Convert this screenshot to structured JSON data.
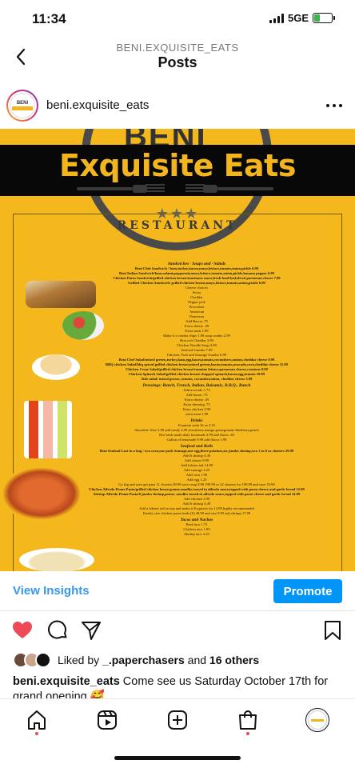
{
  "status_bar": {
    "time": "11:34",
    "network": "5GE",
    "battery_level": 0.35,
    "battery_color": "#3bb54a"
  },
  "header": {
    "subtitle": "BENI.EXQUISITE_EATS",
    "title": "Posts",
    "back_icon": "chevron-left-icon"
  },
  "post": {
    "username": "beni.exquisite_eats",
    "more_icon": "more-horizontal-icon",
    "image": {
      "logo_partial": "BENI",
      "brand_title": "Exquisite Eats",
      "subtitle": "RESTAURANT",
      "stars": "★★★",
      "background_color": "#f4b71c",
      "menu_lines": [
        {
          "text": "Sandwiches · Soups and · Salads",
          "style": "h"
        },
        {
          "text": "Beni Club Sandwich / ham,turkey,bacon,mayo,lettuce,tomato,onion,pickle 6.99",
          "style": "b"
        },
        {
          "text": "Beni Italian Sandwich/ham,salami,pepperoni,mayo,lettuce,tomato,onion,pickle,banana pepper 6.99",
          "style": "b"
        },
        {
          "text": "Chicken Parm Sandwich/grilled chicken breast/marinara sauce,fresh basil leaf,sliced parmesan cheese 7.99",
          "style": "b"
        },
        {
          "text": "Grilled Chicken Sandwich/ grilled chicken breast,mayo,lettuce,tomato,onion,pickle 6.99",
          "style": "b"
        },
        {
          "text": "Cheese choices",
          "style": ""
        },
        {
          "text": "Swiss",
          "style": ""
        },
        {
          "text": "Cheddar",
          "style": ""
        },
        {
          "text": "Pepper jack",
          "style": ""
        },
        {
          "text": "Provolone",
          "style": ""
        },
        {
          "text": "American",
          "style": ""
        },
        {
          "text": "Parmesan",
          "style": ""
        },
        {
          "text": "Add Bacon .75",
          "style": ""
        },
        {
          "text": "Extra cheese .49",
          "style": ""
        },
        {
          "text": "Extra meat 1.99",
          "style": ""
        },
        {
          "text": "Make it a combo chips 1.99 soup combo 2.99",
          "style": ""
        },
        {
          "text": "Broccoli Cheddar 3.99",
          "style": ""
        },
        {
          "text": "Chicken Noodle Soup 3.99",
          "style": ""
        },
        {
          "text": "Seafood Gumbo 7.99",
          "style": ""
        },
        {
          "text": "Chicken, Pork and Sausage Gumbo 6.99",
          "style": ""
        },
        {
          "text": "Beni Chef Salad/mixed greens,turkey,ham,egg,bacon,tomato,cucumbers,onions,cheddar cheese 9.99",
          "style": "b"
        },
        {
          "text": "BBQ chicken Salad/bbq spiced grilled chicken breast,mixed greens,bacon,tomato,avocado,corn,cheddar cheese 11.99",
          "style": "b"
        },
        {
          "text": "Chicken Cesar Salad/grilled chicken breast/romaine lettuce,parmesan cheese,croutons 8.99",
          "style": "b"
        },
        {
          "text": "Chicken Spinach Salad/grilled chicken breast chopped spinach,bacon,egg,tomato 10.99",
          "style": "b"
        },
        {
          "text": "Side salad/ mixed greens, tomato, cucumber,onion, cheddar cheese 3.99",
          "style": "b"
        },
        {
          "text": "Dressings: Ranch, French, Italian, Balsamic, B.B.Q., Ranch",
          "style": "h"
        },
        {
          "text": "Add avocado 1.75",
          "style": ""
        },
        {
          "text": "Add bacon .75",
          "style": ""
        },
        {
          "text": "Extra cheese .49",
          "style": ""
        },
        {
          "text": "Extra dressing .75",
          "style": ""
        },
        {
          "text": "Extra chicken 2.99",
          "style": ""
        },
        {
          "text": "extra meat 1.99",
          "style": ""
        },
        {
          "text": "Drinks",
          "style": "h"
        },
        {
          "text": "Fountain soda 16 oz 2.25",
          "style": ""
        },
        {
          "text": "Smoothie 16oz 3.99 add candy 4.99 strawberry,mango,pomegranate blueberry,peach",
          "style": ""
        },
        {
          "text": "Hot fresh made daily lemonade 2.99 add flavor .49",
          "style": ""
        },
        {
          "text": "Gallon of lemonade 9.99 add flavor 1.99",
          "style": ""
        },
        {
          "text": "Seafood and Boils",
          "style": "h"
        },
        {
          "text": "Beni Seafood Lust in a bag / two corn,one pork Sausage,one egg,three potatoes,six jumbo shrimp,two 3 to 6 oz clusters 29.99",
          "style": "b"
        },
        {
          "text": "Add 6 shrimp 4.49",
          "style": ""
        },
        {
          "text": "Add cluster 9.99",
          "style": ""
        },
        {
          "text": "Add lobster tail 14.99",
          "style": ""
        },
        {
          "text": "Add sausage 2.25",
          "style": ""
        },
        {
          "text": "Add corn 1.99",
          "style": ""
        },
        {
          "text": "Add egg 1.25",
          "style": ""
        },
        {
          "text": "Go big and save get pans 11 clusters 99.99 save coup 9.99 199.99 or 22 clusters for 199.99 and save 19.99",
          "style": ""
        },
        {
          "text": "Chicken Alfredo Penne Pasta/grilled chicken breast,penne noodles tossed in alfredo sauce,topped with parm cheese and garlic bread 12.99",
          "style": "b"
        },
        {
          "text": "Shrimp Alfredo Penne Pasta/6 jumbo shrimp,penne, noodles tossed in alfredo sauce,topped with parm cheese and garlic bread 14.99",
          "style": "b"
        },
        {
          "text": "Add chicken 2.99",
          "style": ""
        },
        {
          "text": "Add 6 shrimp 4.49",
          "style": ""
        },
        {
          "text": "Add a lobster tail on top and make it Exquisite for 14.99 highly recommended",
          "style": ""
        },
        {
          "text": "Family size chicken pasta feeds (6) 48.99 and size 8.95 sub shrimp 17.99",
          "style": ""
        },
        {
          "text": "Tacos and Nachos",
          "style": "h"
        },
        {
          "text": "Beef taco 1.75",
          "style": ""
        },
        {
          "text": "Chicken taco 1.85",
          "style": ""
        },
        {
          "text": "Shrimp taco 2.25",
          "style": ""
        }
      ]
    },
    "insights_label": "View Insights",
    "promote_label": "Promote",
    "actions": {
      "like_icon": "heart-filled-icon",
      "like_color": "#ed4956",
      "comment_icon": "comment-icon",
      "share_icon": "send-icon",
      "save_icon": "bookmark-icon"
    },
    "likes": {
      "prefix": "Liked by ",
      "user": "_.paperchasers",
      "middle": " and ",
      "others": "16 others"
    },
    "caption": {
      "username": "beni.exquisite_eats",
      "text": " Come see us Saturday October 17th for grand opening 🥰"
    }
  },
  "bottom_nav": {
    "items": [
      "home-icon",
      "reels-icon",
      "new-post-icon",
      "shop-icon",
      "profile-avatar"
    ],
    "notification_color": "#ed4956"
  }
}
